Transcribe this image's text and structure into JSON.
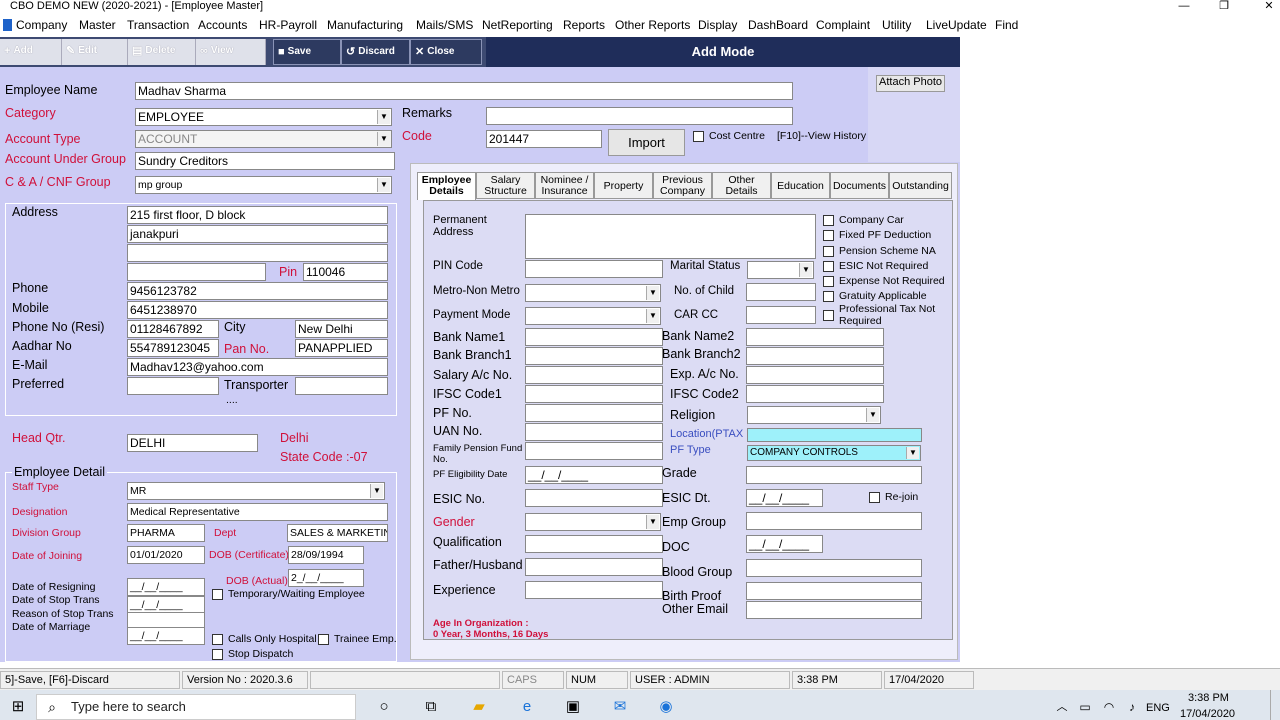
{
  "window": {
    "title": "CBO DEMO NEW (2020-2021) - [Employee Master]",
    "min": "—",
    "max": "❐",
    "close": "✕"
  },
  "menu": [
    "Company",
    "Master",
    "Transaction",
    "Accounts",
    "HR-Payroll",
    "Manufacturing",
    "Mails/SMS",
    "NetReporting",
    "Reports",
    "Other Reports",
    "Display",
    "DashBoard",
    "Complaint",
    "Utility",
    "LiveUpdate",
    "Find"
  ],
  "toolbar": {
    "add": "Add",
    "edit": "Edit",
    "delete": "Delete",
    "view": "View",
    "save": "Save",
    "discard": "Discard",
    "close": "Close",
    "mode": "Add Mode"
  },
  "top": {
    "employee_name_label": "Employee Name",
    "employee_name": "Madhav Sharma",
    "category_label": "Category",
    "category": "EMPLOYEE",
    "account_type_label": "Account Type",
    "account_type": "ACCOUNT",
    "account_under_group_label": "Account Under Group",
    "account_under_group": "Sundry Creditors",
    "cnf_group_label": "C & A / CNF  Group",
    "cnf_group": "mp group",
    "remarks_label": "Remarks",
    "remarks": "",
    "code_label": "Code",
    "code": "201447",
    "import_button": "Import",
    "cost_centre": "Cost Centre",
    "history_hint": "[F10]--View History",
    "attach_photo": "Attach Photo"
  },
  "address": {
    "address_label": "Address",
    "line1": "215  first floor, D block",
    "line2": "janakpuri",
    "line3": "",
    "line4": "",
    "pin_label": "Pin",
    "pin": "110046",
    "phone_label": "Phone",
    "phone": "9456123782",
    "mobile_label": "Mobile",
    "mobile": "6451238970",
    "phone_resi_label": "Phone No (Resi)",
    "phone_resi": "01128467892",
    "city_label": "City",
    "city": "New Delhi",
    "aadhar_label": "Aadhar No",
    "aadhar": "554789123045",
    "pan_label": "Pan No.",
    "pan": "PANAPPLIED",
    "email_label": "E-Mail",
    "email": "Madhav123@yahoo.com",
    "preferred_label": "Preferred",
    "transporter_label": "Transporter",
    "ellipsis": "....",
    "head_qtr_label": "Head Qtr.",
    "head_qtr": "DELHI",
    "delhi_label": "Delhi",
    "state_code": "State Code :-07"
  },
  "employee_detail": {
    "title": "Employee Detail",
    "staff_type_label": "Staff Type",
    "staff_type": "MR",
    "designation_label": "Designation",
    "designation": "Medical Representative",
    "division_group_label": "Division Group",
    "division_group": "PHARMA",
    "dept_label": "Dept",
    "dept": "SALES & MARKETING",
    "doj_label": "Date of Joining",
    "doj": "01/01/2020",
    "dob_cert_label": "DOB (Certificate)",
    "dob_cert": "28/09/1994",
    "dob_actual_label": "DOB (Actual)",
    "dob_actual": "2_/__/____",
    "resigning_label": "Date of Resigning",
    "stop_trans_label": "Date of Stop Trans",
    "stop_reason_label": "Reason of Stop Trans",
    "marriage_label": "Date of Marriage",
    "blank_date": "__/__/____",
    "temporary": "Temporary/Waiting Employee",
    "calls_only": "Calls Only Hospital",
    "trainee": "Trainee Emp.",
    "stop_dispatch": "Stop Dispatch"
  },
  "tabs": [
    {
      "l1": "Employee",
      "l2": "Details"
    },
    {
      "l1": "Salary",
      "l2": "Structure"
    },
    {
      "l1": "Nominee /",
      "l2": "Insurance"
    },
    {
      "l1": "Property",
      "l2": ""
    },
    {
      "l1": "Previous",
      "l2": "Company"
    },
    {
      "l1": "Other",
      "l2": "Details"
    },
    {
      "l1": "Education",
      "l2": ""
    },
    {
      "l1": "Documents",
      "l2": ""
    },
    {
      "l1": "Outstanding",
      "l2": ""
    }
  ],
  "details": {
    "permanent_address": "Permanent\nAddress",
    "pin_code": "PIN Code",
    "marital_status": "Marital Status",
    "metro": "Metro-Non Metro",
    "no_of_child": "No. of Child",
    "payment_mode": "Payment Mode",
    "car_cc": "CAR CC",
    "bank_name1": "Bank Name1",
    "bank_name2": "Bank Name2",
    "bank_branch1": "Bank Branch1",
    "bank_branch2": "Bank Branch2",
    "salary_ac": "Salary A/c No.",
    "exp_ac": "Exp. A/c No.",
    "ifsc1": "IFSC Code1",
    "ifsc2": "IFSC Code2",
    "pf_no": "PF No.",
    "religion": "Religion",
    "uan_no": "UAN No.",
    "location": "Location(PTAX",
    "family_pension": "Family Pension Fund",
    "family_pension2": "No.",
    "pf_type": "PF Type",
    "pf_type_value": "COMPANY CONTROLS",
    "pf_eligibility": "PF Eligibility Date",
    "pf_eligibility_value": "__/__/____",
    "grade": "Grade",
    "esic_no": "ESIC No.",
    "esic_dt": "ESIC  Dt.",
    "esic_dt_value": "__/__/____",
    "rejoin": "Re-join",
    "gender": "Gender",
    "emp_group": "Emp Group",
    "qualification": "Qualification",
    "doc": "DOC",
    "doc_value": "__/__/____",
    "father": "Father/Husband",
    "blood_group": "Blood Group",
    "experience": "Experience",
    "birth_proof": "Birth Proof",
    "other_email": "Other Email",
    "age_title": "Age In Organization :",
    "age_value": "0 Year, 3 Months, 16 Days",
    "checks": [
      "Company Car",
      "Fixed PF Deduction",
      "Pension Scheme NA",
      "ESIC Not Required",
      "Expense Not Required",
      "Gratuity Applicable",
      "Professional Tax Not",
      "Required"
    ]
  },
  "status": {
    "hint": "5]-Save, [F6]-Discard",
    "version": "Version No  :  2020.3.6",
    "caps": "CAPS",
    "num": "NUM",
    "user": "USER : ADMIN",
    "time": "3:38 PM",
    "date": "17/04/2020"
  },
  "taskbar": {
    "search": "Type here to search",
    "lang": "ENG",
    "clock_time": "3:38 PM",
    "clock_date": "17/04/2020"
  }
}
